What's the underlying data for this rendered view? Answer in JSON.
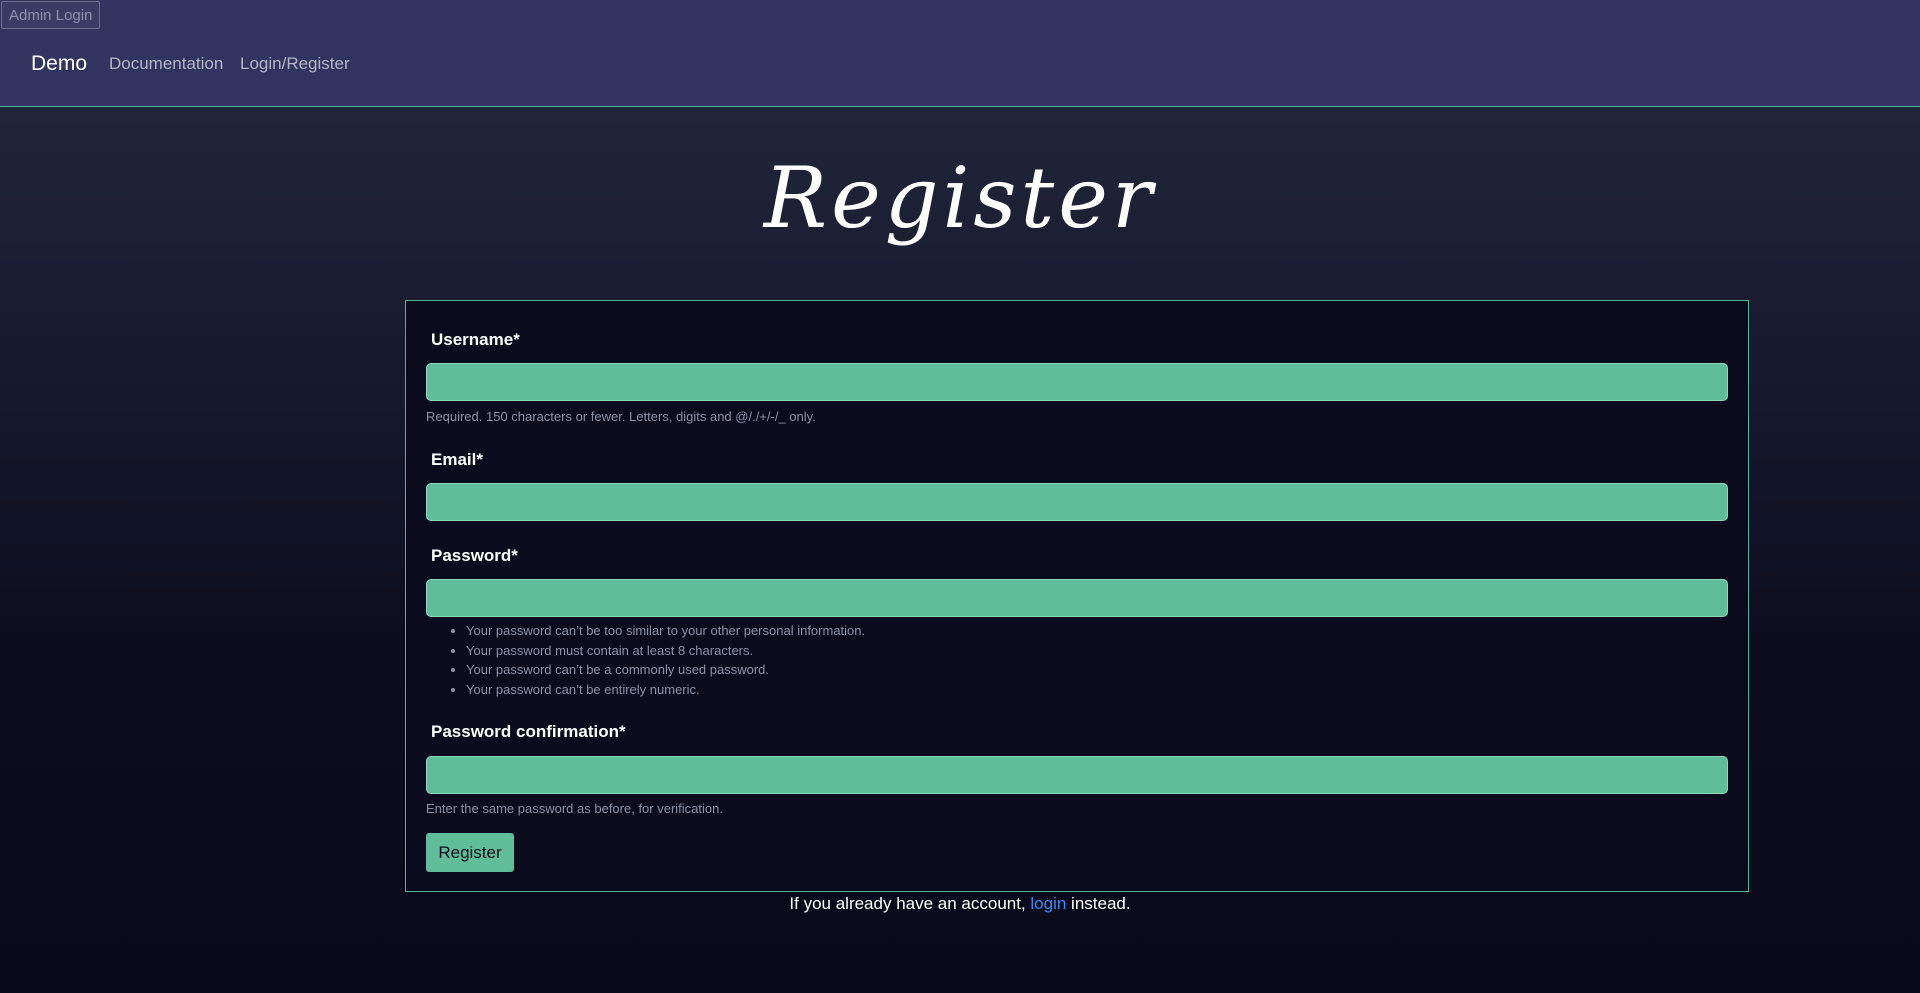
{
  "header": {
    "admin_login": "Admin Login",
    "brand": "Demo",
    "nav": {
      "documentation": "Documentation",
      "login_register": "Login/Register"
    }
  },
  "page": {
    "title": "Register"
  },
  "form": {
    "username": {
      "label": "Username*",
      "value": "",
      "help": "Required. 150 characters or fewer. Letters, digits and @/./+/-/_ only."
    },
    "email": {
      "label": "Email*",
      "value": ""
    },
    "password": {
      "label": "Password*",
      "value": "",
      "rules": [
        "Your password can’t be too similar to your other personal information.",
        "Your password must contain at least 8 characters.",
        "Your password can’t be a commonly used password.",
        "Your password can’t be entirely numeric."
      ]
    },
    "password_confirmation": {
      "label": "Password confirmation*",
      "value": "",
      "help": "Enter the same password as before, for verification."
    },
    "submit_label": "Register"
  },
  "footer": {
    "prefix": "If you already have an account, ",
    "link": "login",
    "suffix": " instead."
  },
  "colors": {
    "navbar": "#31345e",
    "accent": "#5fbe99",
    "border": "#4fb39a",
    "link": "#2f8df5"
  }
}
